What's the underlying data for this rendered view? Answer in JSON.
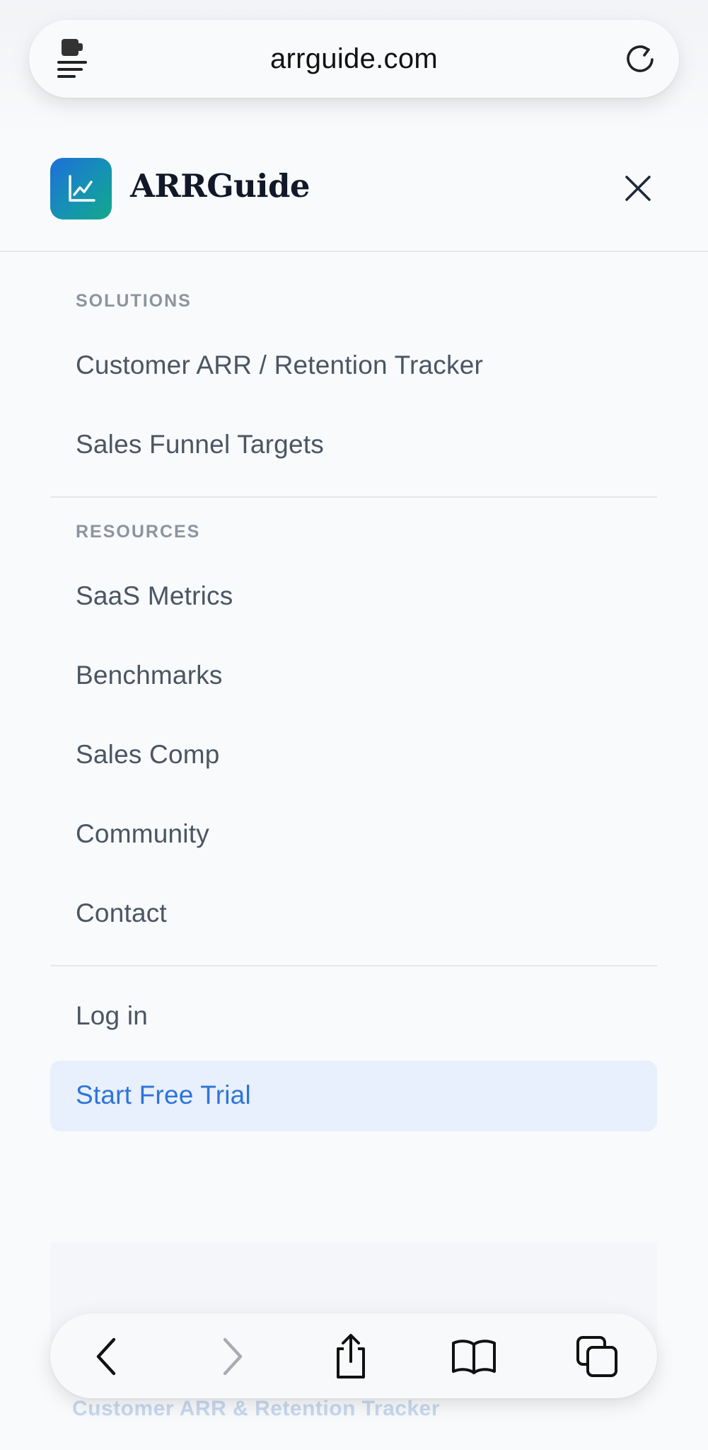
{
  "browser": {
    "url": "arrguide.com",
    "icons": {
      "reader": "reader-extension-icon",
      "reload": "reload-icon",
      "back": "chevron-left-icon",
      "forward": "chevron-right-icon",
      "share": "share-icon",
      "bookmarks": "book-icon",
      "tabs": "tabs-icon"
    }
  },
  "header": {
    "brand": "ARRGuide",
    "logo_icon": "line-chart-icon",
    "close_icon": "close-icon"
  },
  "menu": {
    "solutions": {
      "label": "SOLUTIONS",
      "items": [
        "Customer ARR / Retention Tracker",
        "Sales Funnel Targets"
      ]
    },
    "resources": {
      "label": "RESOURCES",
      "items": [
        "SaaS Metrics",
        "Benchmarks",
        "Sales Comp",
        "Community",
        "Contact"
      ]
    },
    "login": "Log in",
    "cta": "Start Free Trial"
  },
  "footer_text": "Customer ARR & Retention Tracker",
  "colors": {
    "accent": "#2f74d8",
    "cta_bg": "#e8f0fd",
    "logo_gradient_start": "#1e6fd9",
    "logo_gradient_end": "#13a88a",
    "text": "#4b5563",
    "label": "#8d949e"
  }
}
